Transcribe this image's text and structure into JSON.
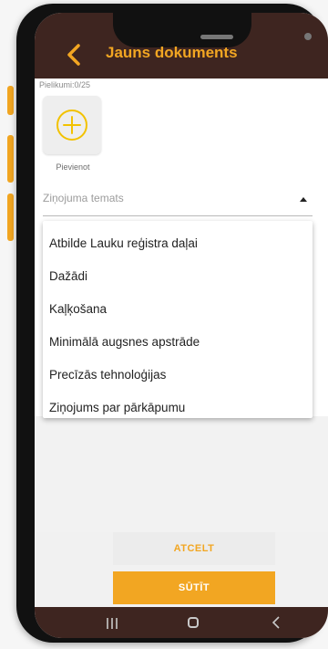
{
  "app_bar": {
    "title": "Jauns dokuments",
    "back_icon": "chevron-left-icon"
  },
  "attachments": {
    "label": "Pielikumi:0/25",
    "add_label": "Pievienot",
    "add_icon": "plus-circle-icon"
  },
  "topic_field": {
    "placeholder": "Ziņojuma temats",
    "arrow_icon": "dropdown-arrow-icon"
  },
  "dropdown": {
    "options": [
      "Atbilde Lauku reģistra daļai",
      "Dažādi",
      "Kaļķošana",
      "Minimālā augsnes apstrāde",
      "Precīzās tehnoloģijas",
      "Ziņojums par pārkāpumu"
    ]
  },
  "actions": {
    "cancel_label": "ATCELT",
    "send_label": "SŪTĪT"
  },
  "colors": {
    "accent": "#f2a622",
    "bar": "#3e2520"
  }
}
